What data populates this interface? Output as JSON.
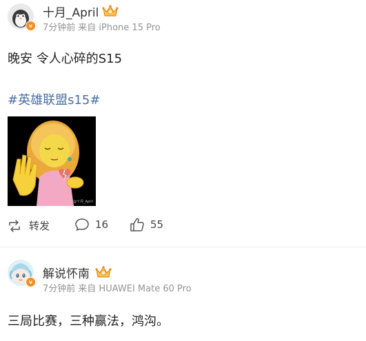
{
  "post1": {
    "username": "十月_April",
    "meta_time": "7分钟前",
    "meta_source": "来自 iPhone 15 Pro",
    "text": "晚安 令人心碎的S15",
    "hashtag": "#英雄联盟s15#",
    "image_watermark": "@十月_April",
    "actions": {
      "repost_label": "转发",
      "comment_count": "16",
      "like_count": "55"
    }
  },
  "post2": {
    "username": "解说怀南",
    "meta_time": "7分钟前",
    "meta_source": "来自 HUAWEI Mate 60 Pro",
    "text": "三局比赛，三种赢法，鸿沟。"
  },
  "colors": {
    "hashtag": "#4a6fa1",
    "verified_badge": "#f78c1f",
    "meta_text": "#939393"
  },
  "icons": [
    "verified-badge-icon",
    "crown-vip-icon",
    "repost-icon",
    "comment-icon",
    "like-icon"
  ]
}
